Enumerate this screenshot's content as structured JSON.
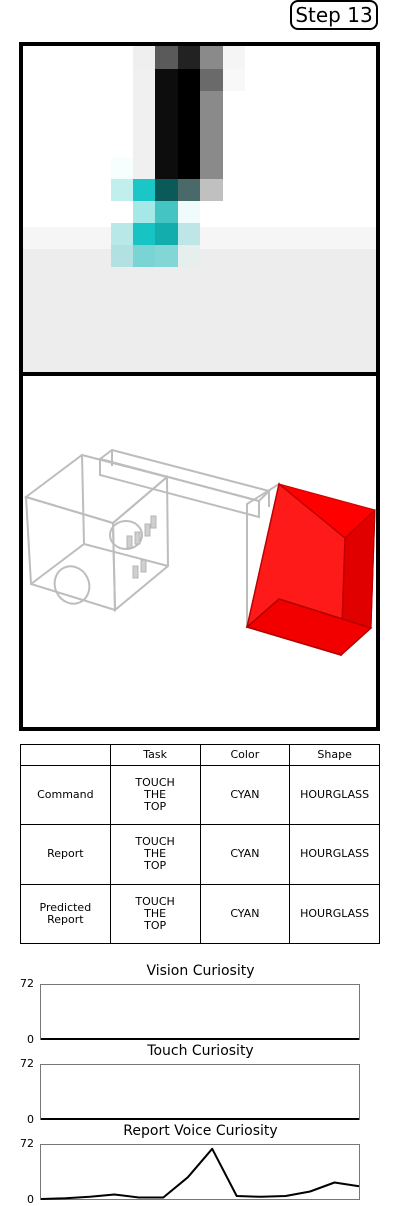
{
  "step_label": "Step 13",
  "table": {
    "headers": [
      "",
      "Task",
      "Color",
      "Shape"
    ],
    "rows": [
      {
        "label": "Command",
        "task": "TOUCH\nTHE\nTOP",
        "color": "CYAN",
        "shape": "HOURGLASS"
      },
      {
        "label": "Report",
        "task": "TOUCH\nTHE\nTOP",
        "color": "CYAN",
        "shape": "HOURGLASS"
      },
      {
        "label": "Predicted\nReport",
        "task": "TOUCH\nTHE\nTOP",
        "color": "CYAN",
        "shape": "HOURGLASS"
      }
    ]
  },
  "colors": {
    "object_red": "#ff0000",
    "cyan": "#1ac6c6",
    "line": "#000000"
  },
  "chart_data": [
    {
      "type": "line",
      "title": "Vision Curiosity",
      "ylim": [
        0,
        72
      ],
      "yticks": [
        "72",
        "0"
      ],
      "x": [
        0,
        1,
        2,
        3,
        4,
        5,
        6,
        7,
        8,
        9,
        10,
        11,
        12,
        13
      ],
      "values": [
        0,
        0,
        0,
        0,
        0,
        0,
        0,
        0,
        0,
        0,
        0,
        0,
        0,
        0
      ]
    },
    {
      "type": "line",
      "title": "Touch Curiosity",
      "ylim": [
        0,
        72
      ],
      "yticks": [
        "72",
        "0"
      ],
      "x": [
        0,
        1,
        2,
        3,
        4,
        5,
        6,
        7,
        8,
        9,
        10,
        11,
        12,
        13
      ],
      "values": [
        0,
        0,
        0,
        0,
        0,
        0,
        0,
        0,
        0,
        0,
        0,
        0,
        0,
        0
      ]
    },
    {
      "type": "line",
      "title": "Report Voice Curiosity",
      "ylim": [
        0,
        72
      ],
      "yticks": [
        "72",
        "0"
      ],
      "x": [
        0,
        1,
        2,
        3,
        4,
        5,
        6,
        7,
        8,
        9,
        10,
        11,
        12,
        13
      ],
      "values": [
        0,
        1,
        3,
        6,
        2,
        2,
        29,
        67,
        4,
        3,
        4,
        10,
        22,
        17
      ]
    }
  ]
}
